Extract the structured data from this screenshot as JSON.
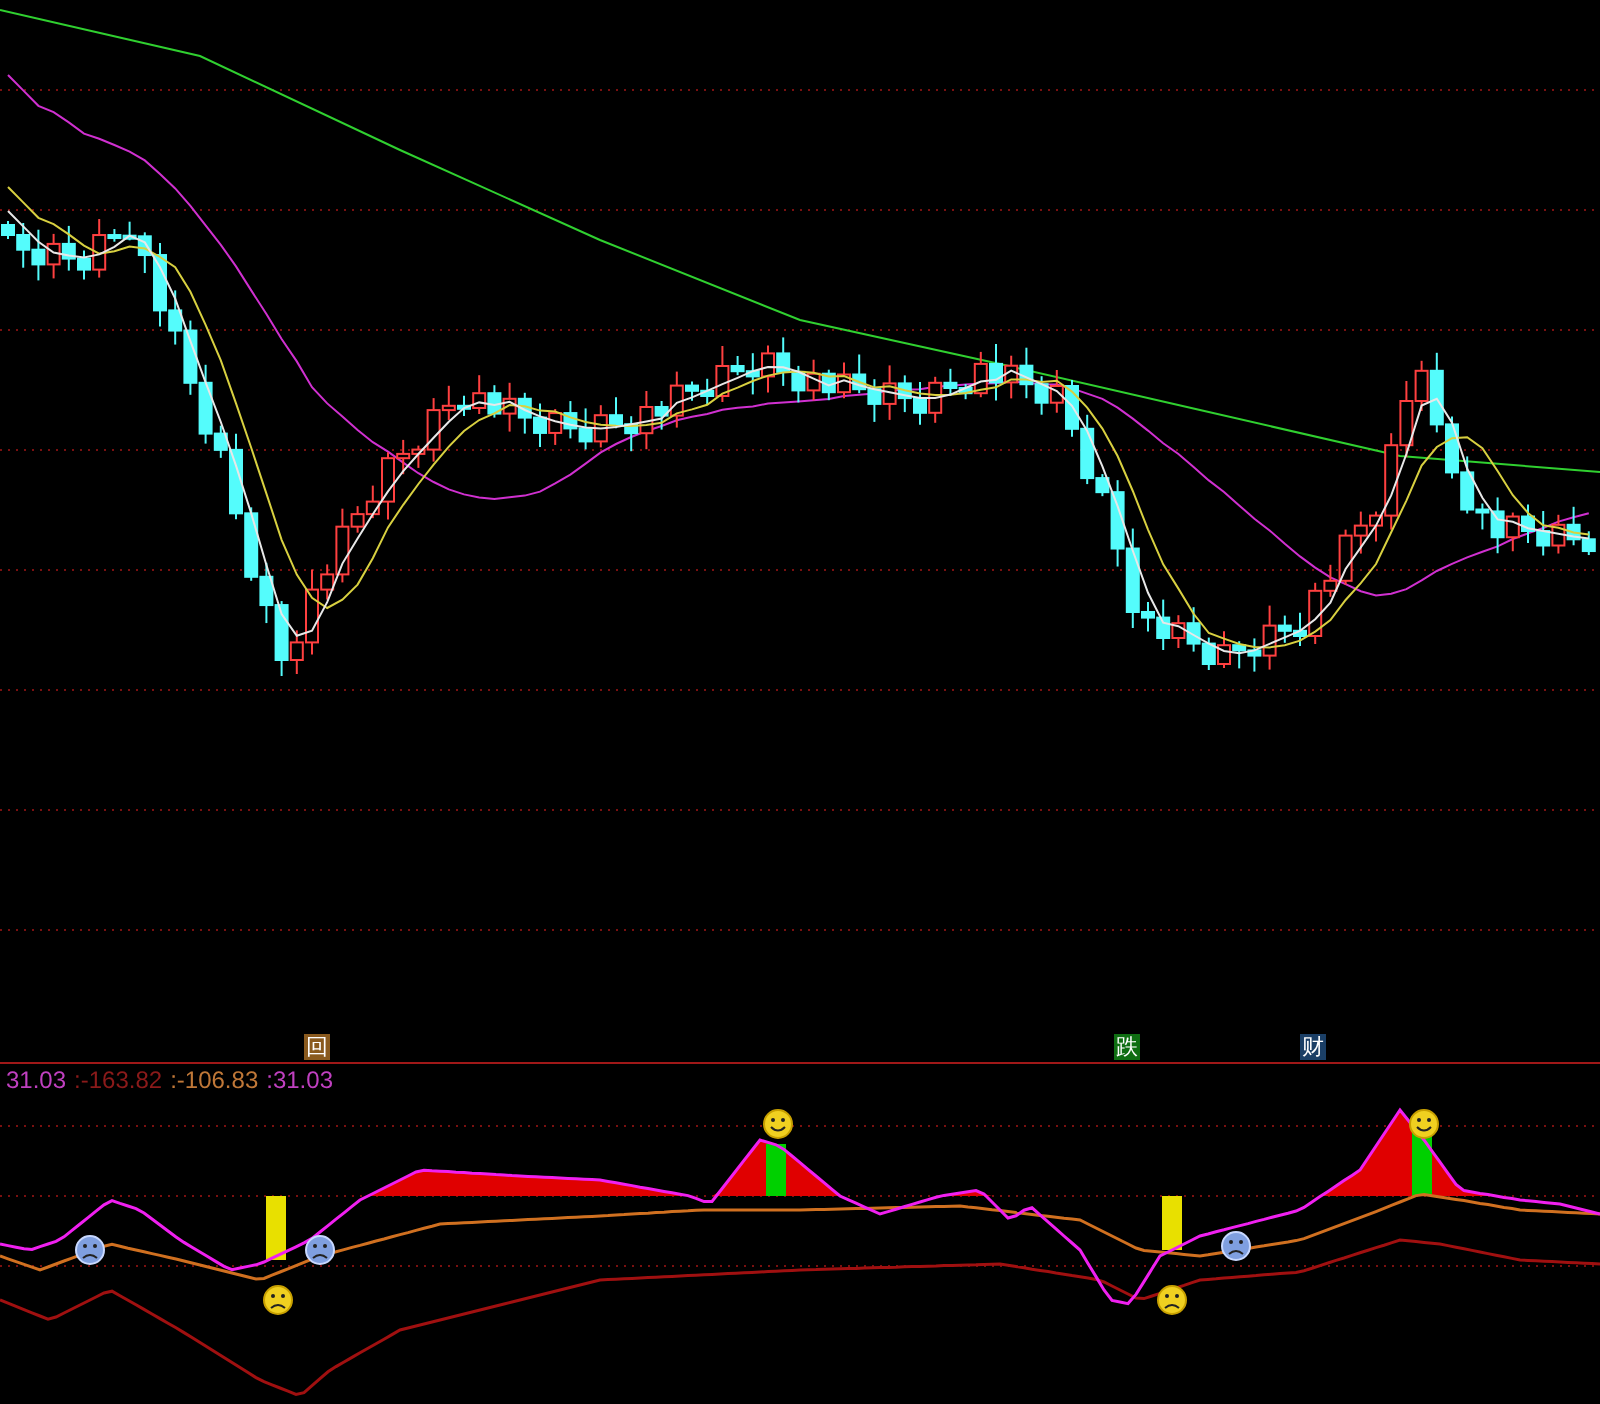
{
  "markers": [
    {
      "label": "回",
      "color": "#8a5a1e"
    },
    {
      "label": "跌",
      "color": "#0f6e12"
    },
    {
      "label": "财",
      "color": "#1b3f66"
    }
  ],
  "readings": [
    {
      "text": "31.03",
      "color": "#c040c0"
    },
    {
      "text": ":-163.82",
      "color": "#8b1a1a"
    },
    {
      "text": ":-106.83",
      "color": "#c07838"
    },
    {
      "text": ":31.03",
      "color": "#c040c0"
    }
  ]
}
